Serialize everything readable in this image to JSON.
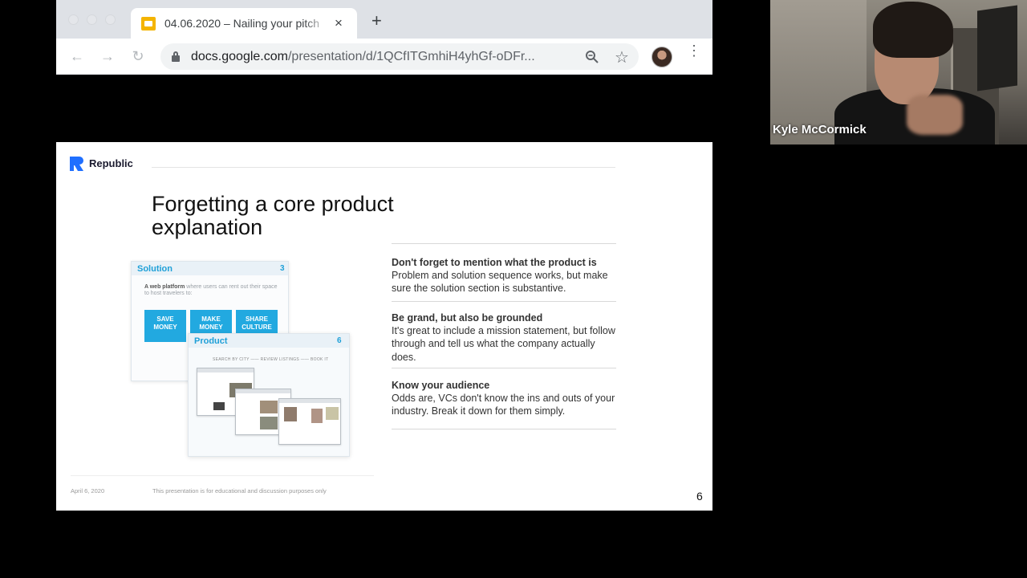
{
  "browser": {
    "tab_title": "04.06.2020 – Nailing your pitch",
    "tab_close": "×",
    "new_tab": "+",
    "nav": {
      "back": "←",
      "forward": "→",
      "reload": "↻"
    },
    "url_host": "docs.google.com",
    "url_path": "/presentation/d/1QCfITGmhiH4yhGf-oDFr...",
    "star": "☆",
    "menu": "⋮"
  },
  "slide": {
    "brand": "Republic",
    "title_line1": "Forgetting a core product",
    "title_line2": "explanation",
    "tips": [
      {
        "heading": "Don't forget to mention what the product is",
        "body": "Problem and solution sequence works, but make sure the solution section is substantive."
      },
      {
        "heading": "Be grand, but also be grounded",
        "body": "It's great to include a mission statement, but follow through and tell us what the company actually does."
      },
      {
        "heading": "Know your audience",
        "body": "Odds are, VCs don't know the ins and outs of your industry. Break it down for them simply."
      }
    ],
    "thumb_solution": {
      "title": "Solution",
      "number": "3",
      "text_bold": "A web platform",
      "text_rest": " where users can rent out their space to host travelers to:",
      "buttons": [
        "SAVE MONEY",
        "MAKE MONEY",
        "SHARE CULTURE"
      ]
    },
    "thumb_product": {
      "title": "Product",
      "number": "6",
      "steps": "SEARCH BY CITY  ——  REVIEW LISTINGS  ——  BOOK IT"
    },
    "footer_date": "April 6, 2020",
    "footer_disclaimer": "This presentation is for educational and discussion purposes only",
    "page_number": "6"
  },
  "video": {
    "participant_name": "Kyle McCormick"
  },
  "colors": {
    "accent_blue": "#1fa0d8",
    "brand_blue": "#1f6fff",
    "slide_bg": "#ffffff",
    "backdrop": "#000000"
  }
}
